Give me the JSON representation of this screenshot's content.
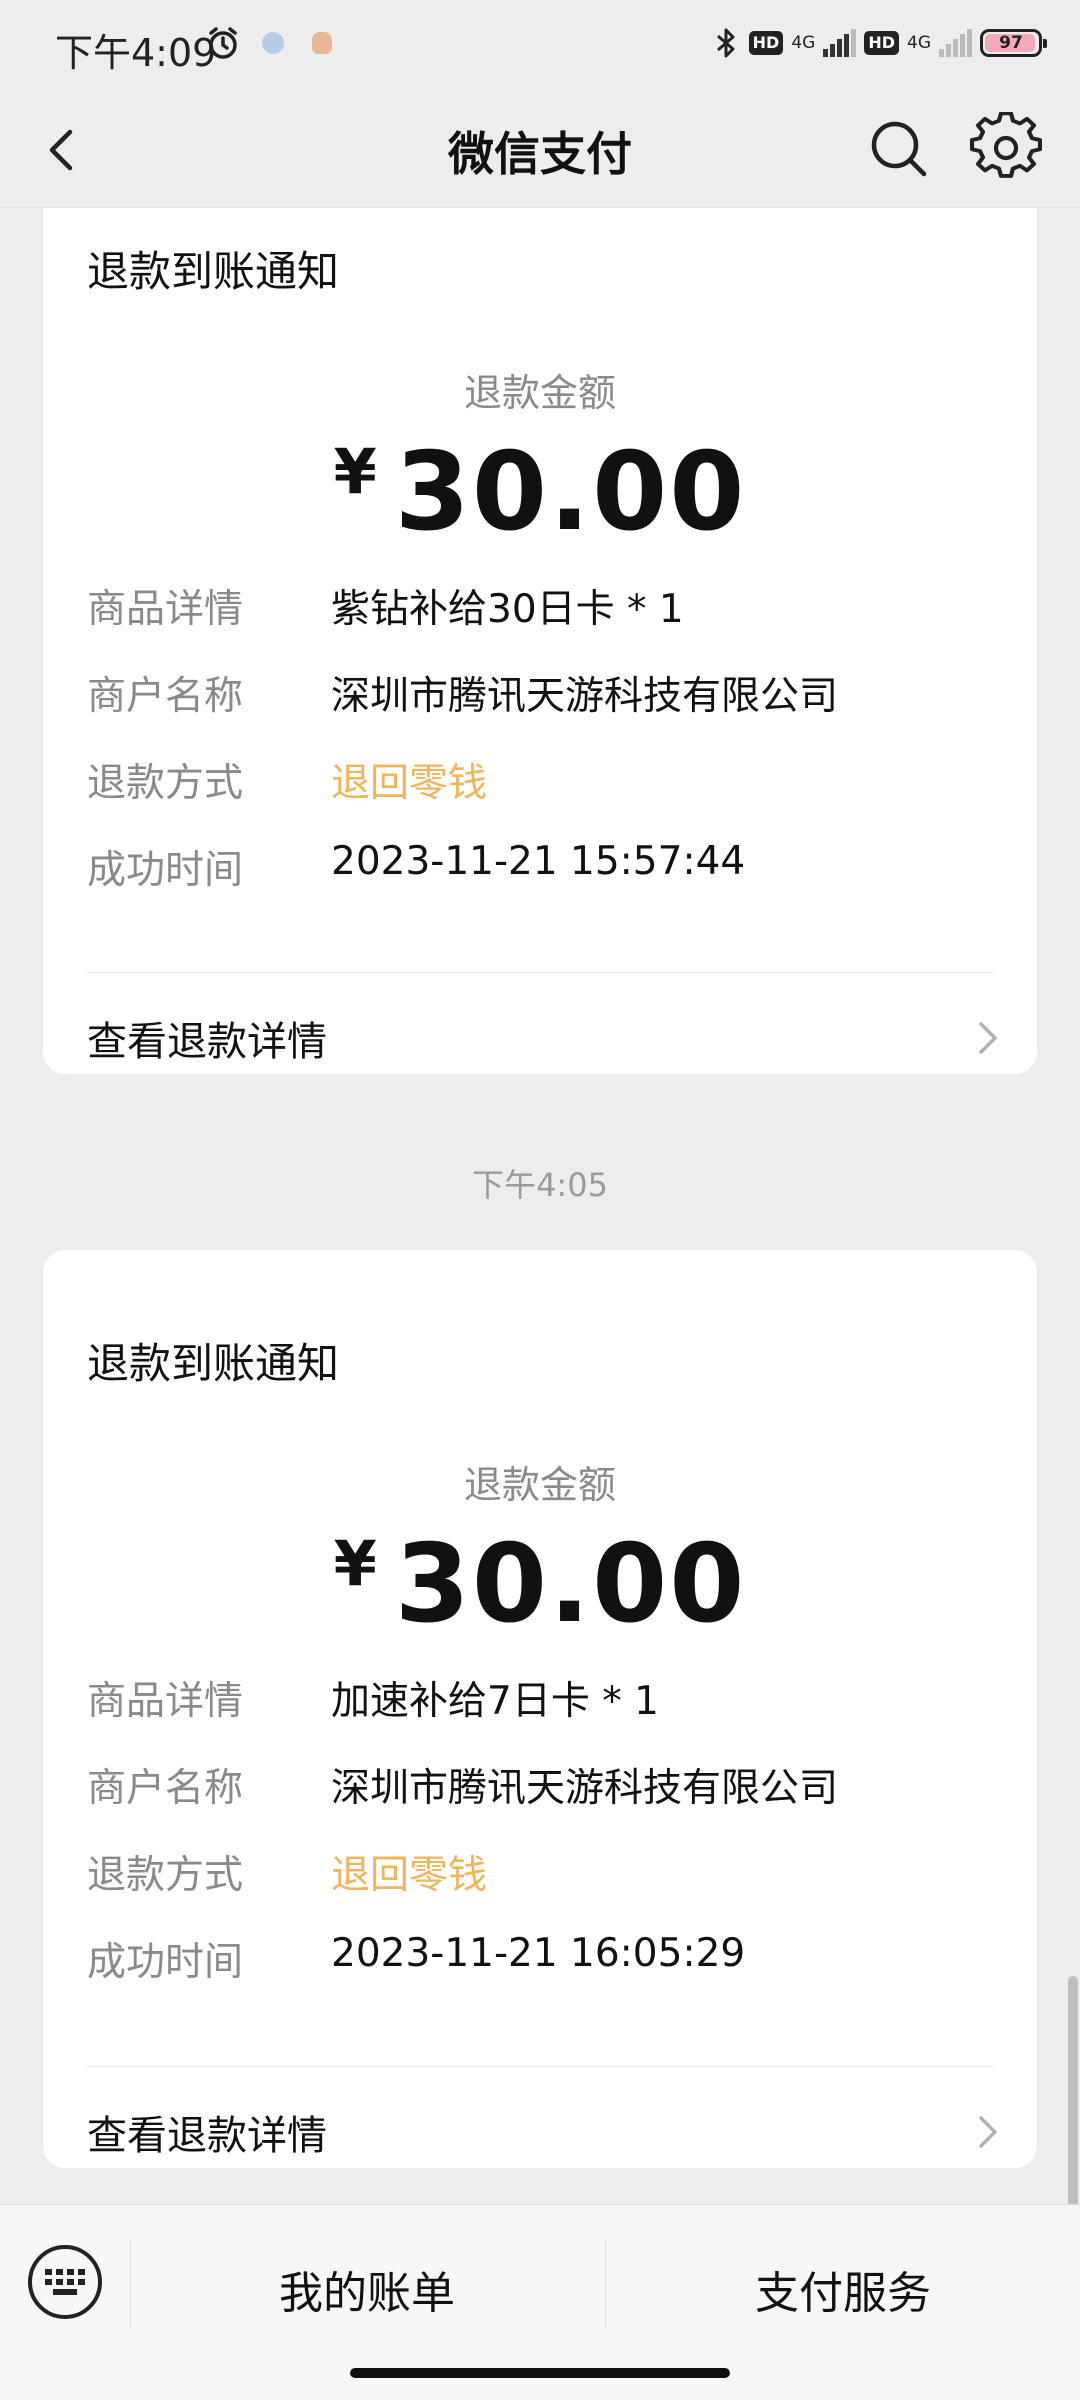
{
  "status_bar": {
    "time": "下午4:09",
    "network1": "4G",
    "network2": "4G",
    "hd": "HD",
    "battery": "97"
  },
  "nav": {
    "title": "微信支付"
  },
  "cards": [
    {
      "title": "退款到账通知",
      "amount_label": "退款金额",
      "currency": "¥",
      "amount": "30.00",
      "rows": [
        {
          "key": "商品详情",
          "value": "紫钻补给30日卡 * 1"
        },
        {
          "key": "商户名称",
          "value": "深圳市腾讯天游科技有限公司"
        },
        {
          "key": "退款方式",
          "value": "退回零钱"
        },
        {
          "key": "成功时间",
          "value": "2023-11-21 15:57:44"
        }
      ],
      "detail_link": "查看退款详情"
    },
    {
      "title": "退款到账通知",
      "amount_label": "退款金额",
      "currency": "¥",
      "amount": "30.00",
      "rows": [
        {
          "key": "商品详情",
          "value": "加速补给7日卡 * 1"
        },
        {
          "key": "商户名称",
          "value": "深圳市腾讯天游科技有限公司"
        },
        {
          "key": "退款方式",
          "value": "退回零钱"
        },
        {
          "key": "成功时间",
          "value": "2023-11-21 16:05:29"
        }
      ],
      "detail_link": "查看退款详情"
    }
  ],
  "timestamp": "下午4:05",
  "bottom_bar": {
    "tab1": "我的账单",
    "tab2": "支付服务"
  },
  "colors": {
    "background": "#ededed",
    "card": "#ffffff",
    "refund_method": "#f0b45a",
    "muted_text": "#8a8a8a"
  },
  "icons": [
    "alarm-icon",
    "bluetooth-icon",
    "back-arrow-icon",
    "search-icon",
    "gear-icon",
    "chevron-right-icon",
    "keyboard-icon"
  ]
}
